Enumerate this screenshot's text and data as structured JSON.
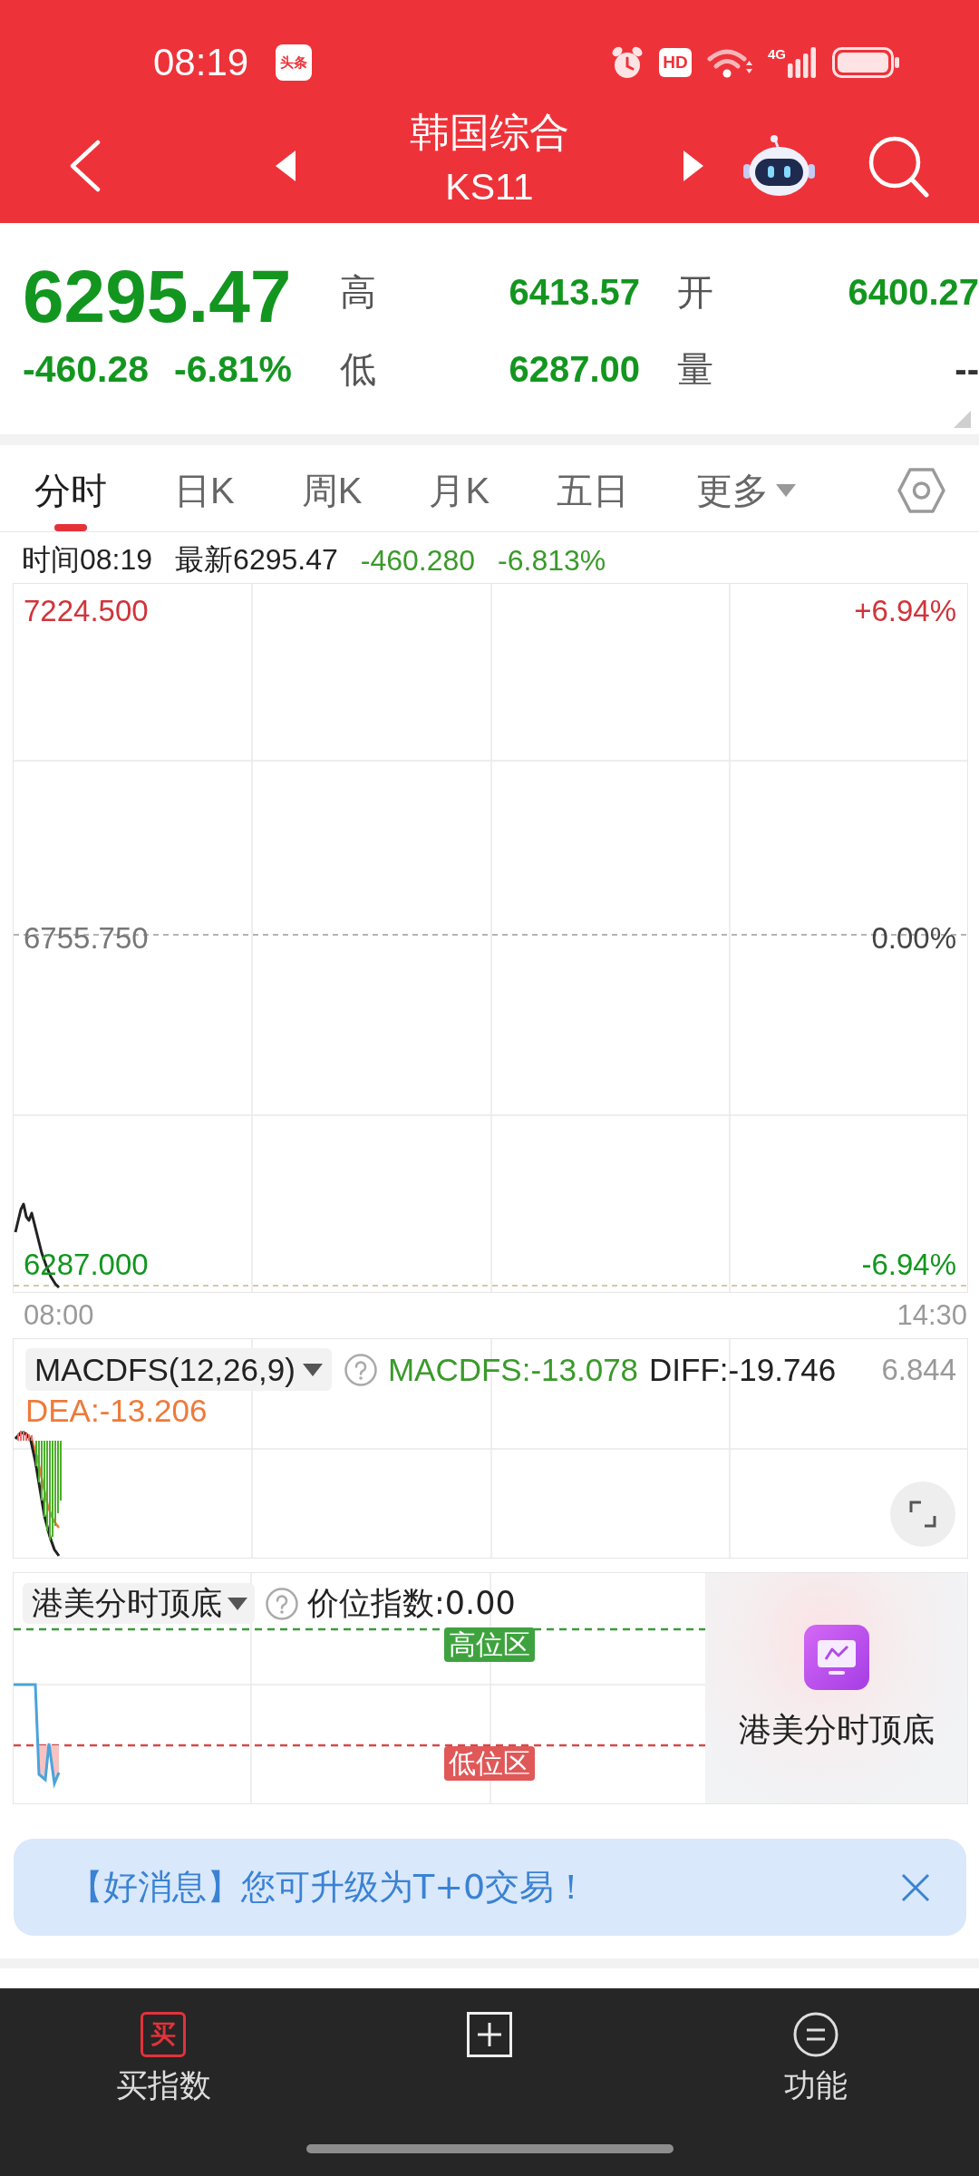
{
  "status_bar": {
    "time": "08:19",
    "notification_badge": "头条",
    "hd_label": "HD",
    "network_label": "4G"
  },
  "header": {
    "title": "韩国综合",
    "code": "KS11"
  },
  "quote": {
    "price": "6295.47",
    "change": "-460.28",
    "change_percent": "-6.81%",
    "stats": [
      {
        "label": "高",
        "value": "6413.57",
        "color": "#13961f"
      },
      {
        "label": "开",
        "value": "6400.27",
        "color": "#13961f"
      },
      {
        "label": "低",
        "value": "6287.00",
        "color": "#13961f"
      },
      {
        "label": "量",
        "value": "--",
        "color": "#333333"
      }
    ]
  },
  "period_tabs": [
    {
      "label": "分时",
      "selected": true,
      "dropdown": false
    },
    {
      "label": "日K",
      "selected": false,
      "dropdown": false
    },
    {
      "label": "周K",
      "selected": false,
      "dropdown": false
    },
    {
      "label": "月K",
      "selected": false,
      "dropdown": false
    },
    {
      "label": "五日",
      "selected": false,
      "dropdown": false
    },
    {
      "label": "更多",
      "selected": false,
      "dropdown": true
    }
  ],
  "info_row": {
    "time": "时间08:19",
    "latest": "最新6295.47",
    "change": "-460.280",
    "change_percent": "-6.813%"
  },
  "price_chart": {
    "max_price": "7224.500",
    "max_percent": "+6.94%",
    "base_price": "6755.750",
    "base_percent": "0.00%",
    "min_price": "6287.000",
    "min_percent": "-6.94%",
    "start_time": "08:00",
    "end_time": "14:30"
  },
  "macd_panel": {
    "indicator": "MACDFS(12,26,9)",
    "macdfs": "MACDFS:-13.078",
    "diff": "DIFF:-19.746",
    "scale_max": "6.844",
    "dea": "DEA:-13.206"
  },
  "position_panel": {
    "indicator": "港美分时顶底",
    "reading": "价位指数:0.00",
    "high_zone": "高位区",
    "low_zone": "低位区",
    "promo_title": "港美分时顶底"
  },
  "banner": {
    "text": "【好消息】您可升级为T+0交易！"
  },
  "bottom_nav": [
    {
      "kind": "buy",
      "icon_text": "买",
      "label": "买指数"
    },
    {
      "kind": "add"
    },
    {
      "kind": "functions",
      "label": "功能"
    }
  ]
}
